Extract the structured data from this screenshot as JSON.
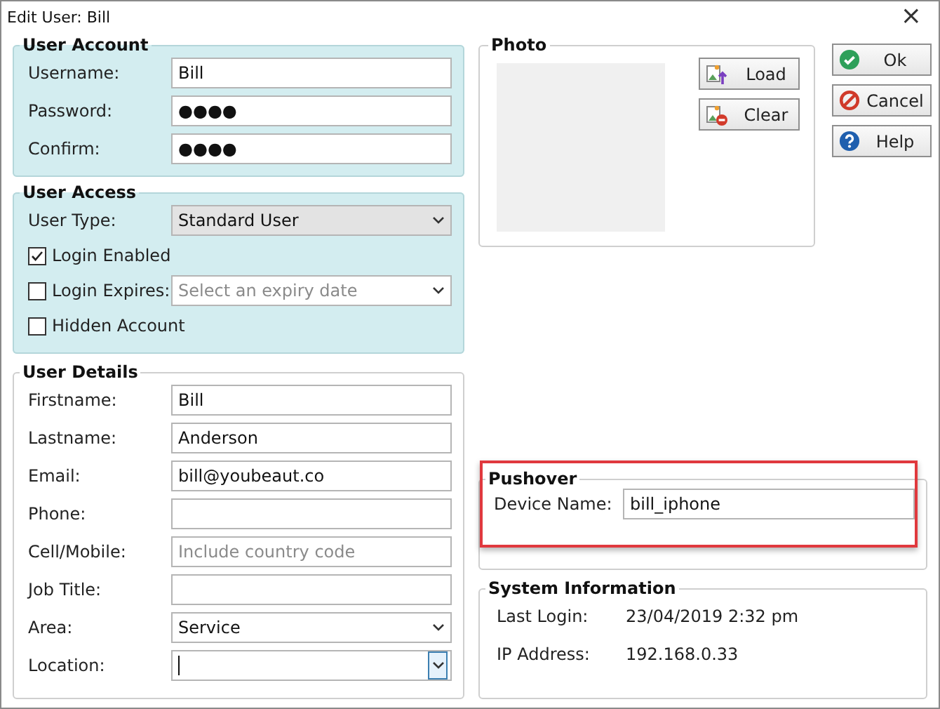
{
  "window": {
    "title": "Edit User: Bill",
    "close": "×"
  },
  "user_account": {
    "title": "User Account",
    "fields": [
      {
        "label": "Username:",
        "kind": "text",
        "value": "Bill"
      },
      {
        "label": "Password:",
        "kind": "text",
        "value": "●●●●"
      },
      {
        "label": "Confirm:",
        "kind": "text",
        "value": "●●●●"
      }
    ]
  },
  "user_access": {
    "title": "User Access",
    "rows": [
      {
        "kind": "select",
        "label": "User Type:",
        "value": "Standard User",
        "disabled": true
      },
      {
        "kind": "checkbox",
        "label": "Login Enabled",
        "checked": true
      },
      {
        "kind": "checkbox_select",
        "label": "Login Expires:",
        "checked": false,
        "placeholder": "Select an expiry date"
      },
      {
        "kind": "checkbox",
        "label": "Hidden Account",
        "checked": false
      }
    ]
  },
  "user_details": {
    "title": "User Details",
    "fields": [
      {
        "label": "Firstname:",
        "kind": "text",
        "value": "Bill"
      },
      {
        "label": "Lastname:",
        "kind": "text",
        "value": "Anderson"
      },
      {
        "label": "Email:",
        "kind": "text",
        "value": "bill@youbeaut.co"
      },
      {
        "label": "Phone:",
        "kind": "text"
      },
      {
        "label": "Cell/Mobile:",
        "kind": "text",
        "placeholder": "Include country code"
      },
      {
        "label": "Job Title:",
        "kind": "text"
      },
      {
        "label": "Area:",
        "kind": "select",
        "value": "Service"
      },
      {
        "label": "Location:",
        "kind": "select",
        "focused": true
      }
    ]
  },
  "photo": {
    "title": "Photo",
    "buttons": [
      {
        "label": "Load",
        "kind": "load"
      },
      {
        "label": "Clear",
        "kind": "clear"
      }
    ]
  },
  "dialog_buttons": [
    {
      "label": "Ok",
      "kind": "ok"
    },
    {
      "label": "Cancel",
      "kind": "cancel"
    },
    {
      "label": "Help",
      "kind": "help"
    }
  ],
  "pushover": {
    "title": "Pushover",
    "highlighted": true,
    "field": {
      "label": "Device Name:",
      "value": "bill_iphone"
    }
  },
  "system_information": {
    "title": "System Information",
    "rows": [
      {
        "label": "Last Login:",
        "value": "23/04/2019 2:32 pm"
      },
      {
        "label": "IP Address:",
        "value": "192.168.0.33"
      }
    ]
  }
}
